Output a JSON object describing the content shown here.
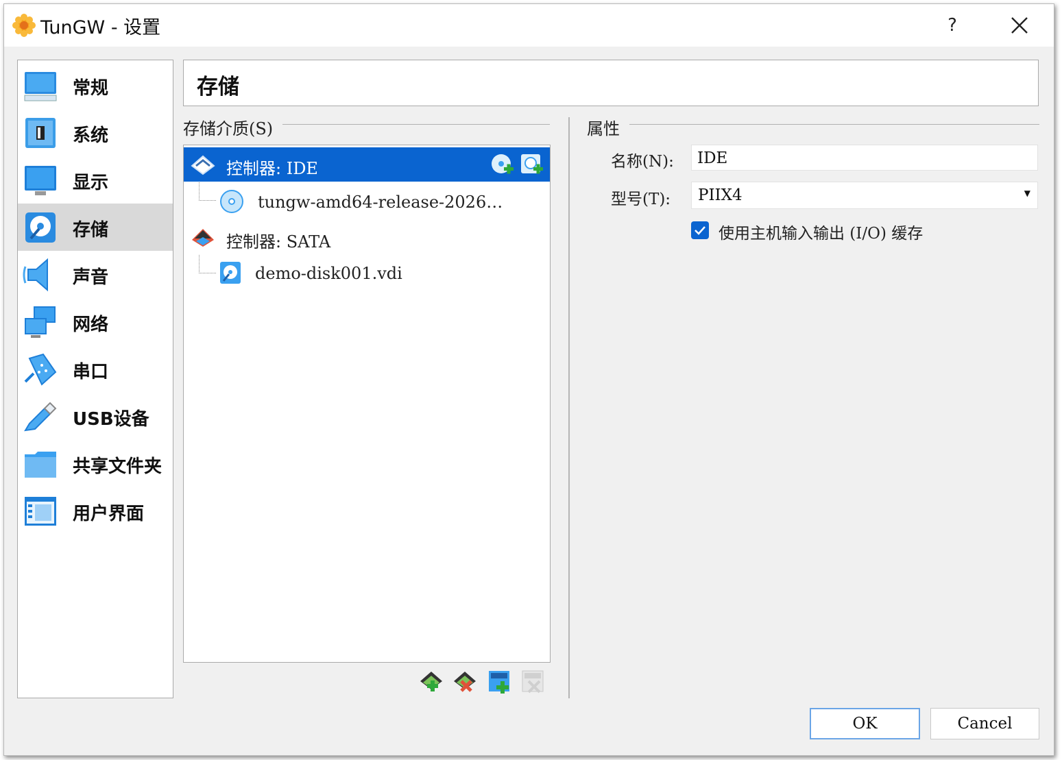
{
  "window": {
    "title": "TunGW - 设置",
    "help_label": "?",
    "close_label": "✕"
  },
  "sidebar": {
    "items": [
      {
        "label": "常规",
        "icon": "monitor-general-icon"
      },
      {
        "label": "系统",
        "icon": "system-chip-icon"
      },
      {
        "label": "显示",
        "icon": "display-icon"
      },
      {
        "label": "存储",
        "icon": "storage-disk-icon",
        "selected": true
      },
      {
        "label": "声音",
        "icon": "speaker-icon"
      },
      {
        "label": "网络",
        "icon": "network-icon"
      },
      {
        "label": "串口",
        "icon": "serial-port-icon"
      },
      {
        "label": "USB设备",
        "icon": "usb-icon"
      },
      {
        "label": "共享文件夹",
        "icon": "shared-folder-icon"
      },
      {
        "label": "用户界面",
        "icon": "user-interface-icon"
      }
    ]
  },
  "page": {
    "title": "存储"
  },
  "storage": {
    "group_label": "存储介质(S)",
    "tree": [
      {
        "label": "控制器: IDE",
        "type": "controller",
        "selected": true
      },
      {
        "label": "tungw-amd64-release-2026…",
        "type": "optical"
      },
      {
        "label": "控制器: SATA",
        "type": "controller"
      },
      {
        "label": "demo-disk001.vdi",
        "type": "hard-disk"
      }
    ]
  },
  "properties": {
    "group_label": "属性",
    "name_label": "名称(N):",
    "name_value": "IDE",
    "type_label": "型号(T):",
    "type_value": "PIIX4",
    "host_io_cache_label": "使用主机输入输出 (I/O) 缓存",
    "host_io_cache_checked": true
  },
  "buttons": {
    "ok": "OK",
    "cancel": "Cancel"
  },
  "colors": {
    "selection": "#0a64d0",
    "window_bg": "#f0f0f0"
  }
}
